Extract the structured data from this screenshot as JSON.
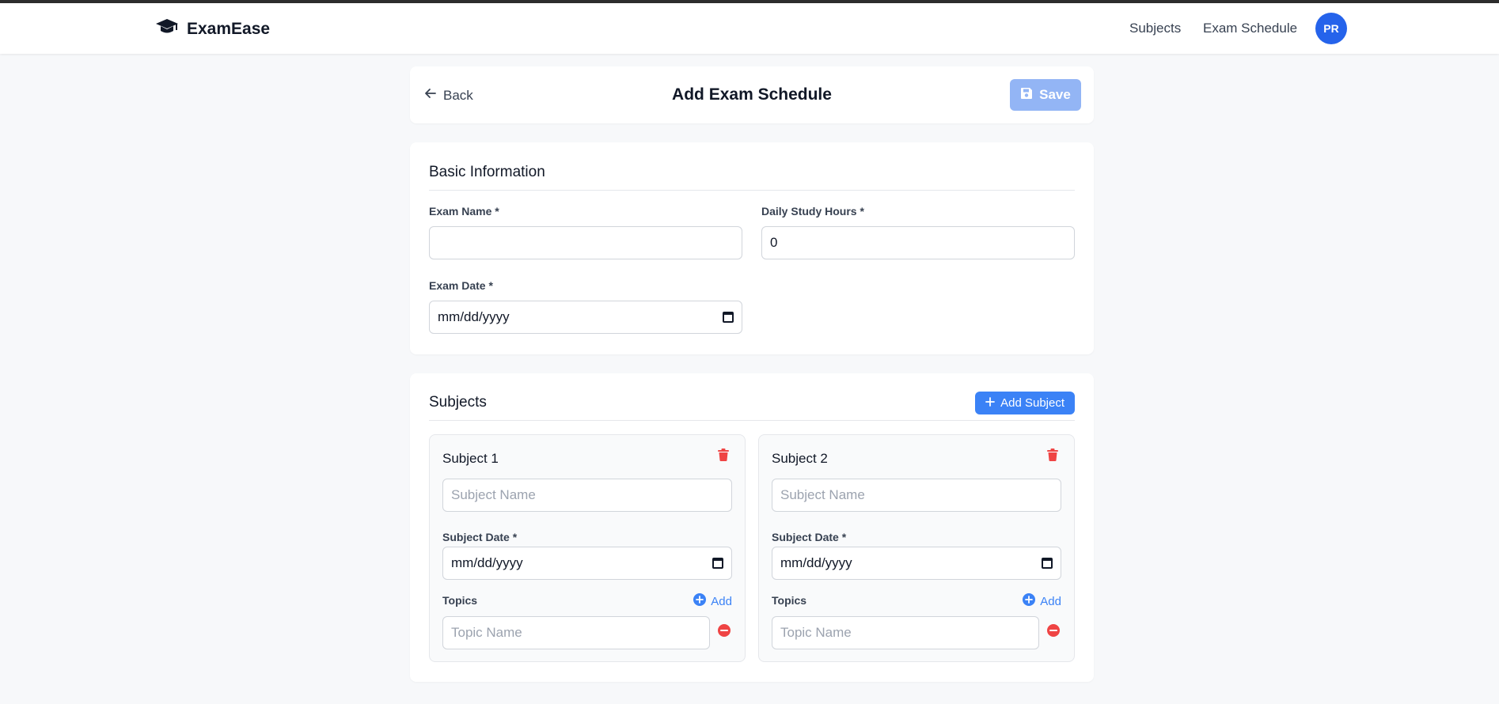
{
  "app": {
    "name": "ExamEase"
  },
  "nav": {
    "subjects": "Subjects",
    "exam_schedule": "Exam Schedule",
    "avatar_initials": "PR"
  },
  "header": {
    "back_label": "Back",
    "title": "Add Exam Schedule",
    "save_label": "Save"
  },
  "basic": {
    "title": "Basic Information",
    "exam_name_label": "Exam Name *",
    "exam_name_value": "",
    "daily_hours_label": "Daily Study Hours *",
    "daily_hours_value": "0",
    "exam_date_label": "Exam Date *",
    "exam_date_value": "mm/dd/yyyy"
  },
  "subjects": {
    "title": "Subjects",
    "add_label": "Add Subject",
    "items": [
      {
        "title": "Subject 1",
        "name_placeholder": "Subject Name",
        "date_label": "Subject Date *",
        "date_value": "mm/dd/yyyy",
        "topics_label": "Topics",
        "add_topic_label": "Add",
        "topic_placeholder": "Topic Name"
      },
      {
        "title": "Subject 2",
        "name_placeholder": "Subject Name",
        "date_label": "Subject Date *",
        "date_value": "mm/dd/yyyy",
        "topics_label": "Topics",
        "add_topic_label": "Add",
        "topic_placeholder": "Topic Name"
      }
    ]
  },
  "colors": {
    "primary": "#3b82f6",
    "danger": "#ef4444",
    "save_disabled": "#93b5f5"
  }
}
